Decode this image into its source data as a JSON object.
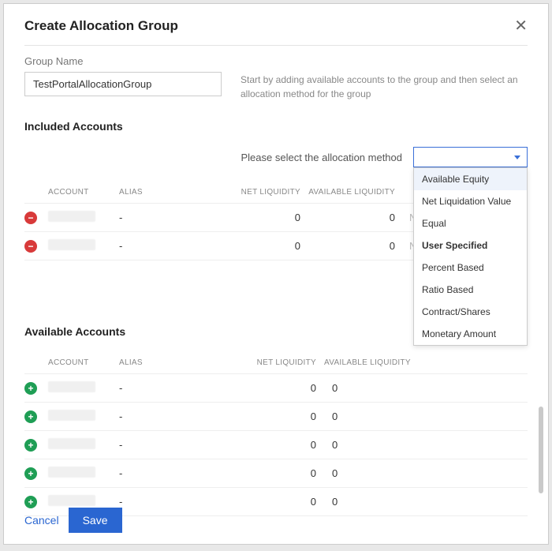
{
  "header": {
    "title": "Create Allocation Group"
  },
  "groupName": {
    "label": "Group Name",
    "value": "TestPortalAllocationGroup"
  },
  "hint": "Start by adding available accounts to the group and then select an allocation method for the group",
  "included": {
    "title": "Included Accounts",
    "allocLabel": "Please select the allocation method",
    "headers": {
      "account": "ACCOUNT",
      "alias": "ALIAS",
      "net": "NET LIQUIDITY",
      "avail": "AVAILABLE LIQUIDITY"
    },
    "rows": [
      {
        "alias": "-",
        "net": "0",
        "avail": "0",
        "note": "No allocation"
      },
      {
        "alias": "-",
        "net": "0",
        "avail": "0",
        "note": "No allocation"
      }
    ]
  },
  "dropdown": {
    "selected": "",
    "options": [
      {
        "label": "Available Equity",
        "highlight": true
      },
      {
        "label": "Net Liquidation Value"
      },
      {
        "label": "Equal"
      },
      {
        "label": "User Specified",
        "bold": true
      },
      {
        "label": "Percent Based"
      },
      {
        "label": "Ratio Based"
      },
      {
        "label": "Contract/Shares"
      },
      {
        "label": "Monetary Amount"
      }
    ]
  },
  "available": {
    "title": "Available Accounts",
    "headers": {
      "account": "ACCOUNT",
      "alias": "ALIAS",
      "net": "NET LIQUIDITY",
      "avail": "AVAILABLE LIQUIDITY"
    },
    "rows": [
      {
        "alias": "-",
        "net": "0",
        "avail": "0"
      },
      {
        "alias": "-",
        "net": "0",
        "avail": "0"
      },
      {
        "alias": "-",
        "net": "0",
        "avail": "0"
      },
      {
        "alias": "-",
        "net": "0",
        "avail": "0"
      },
      {
        "alias": "-",
        "net": "0",
        "avail": "0"
      }
    ]
  },
  "footer": {
    "cancel": "Cancel",
    "save": "Save"
  }
}
